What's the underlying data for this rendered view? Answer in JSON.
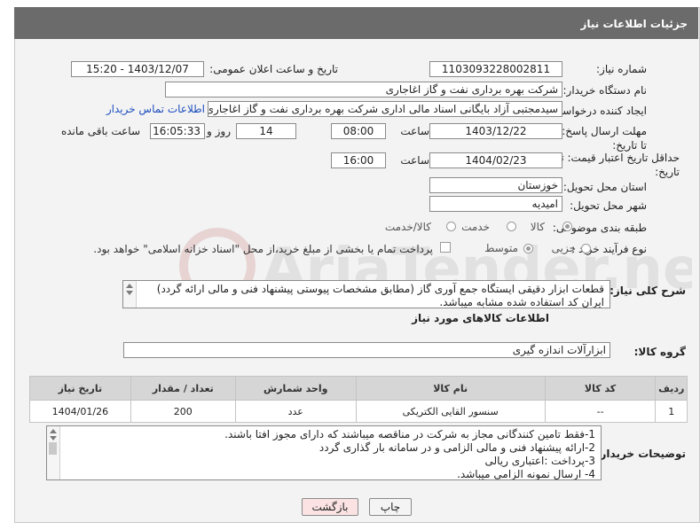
{
  "header": {
    "title": "جزئیات اطلاعات نیاز"
  },
  "fields": {
    "need_number_label": "شماره نیاز:",
    "need_number": "1103093228002811",
    "announce_label": "تاریخ و ساعت اعلان عمومی:",
    "announce_value": "1403/12/07 - 15:20",
    "buyer_org_label": "نام دستگاه خریدار:",
    "buyer_org": "شرکت بهره برداری نفت و گاز اغاجاری",
    "creator_label": "ایجاد کننده درخواست:",
    "creator": "سیدمجتبی آزاد بایگانی اسناد مالی اداری شرکت بهره برداری نفت و گاز اغاجاری",
    "contact_link": "اطلاعات تماس خریدار",
    "deadline_label": "مهلت ارسال پاسخ: تا تاریخ:",
    "deadline_date": "1403/12/22",
    "time_label": "ساعت",
    "deadline_time": "08:00",
    "days_count": "14",
    "days_label": "روز و",
    "remaining_time": "16:05:33",
    "remaining_label": "ساعت باقی مانده",
    "validity_label": "حداقل تاریخ اعتبار قیمت: تا تاریخ:",
    "validity_date": "1404/02/23",
    "validity_time": "16:00",
    "province_label": "استان محل تحویل:",
    "province": "خوزستان",
    "city_label": "شهر محل تحویل:",
    "city": "امیدیه",
    "category_label": "طبقه بندی موضوعی:",
    "category_options": [
      "کالا",
      "خدمت",
      "کالا/خدمت"
    ],
    "process_label": "نوع فرآیند خرید :",
    "process_options": [
      "جزیی",
      "متوسط"
    ],
    "payment_text": "پرداخت تمام یا بخشی از مبلغ خرید،از محل \"اسناد خزانه اسلامی\" خواهد بود."
  },
  "description": {
    "label": "شرح کلی نیاز:",
    "lines": [
      "قطعات ابزار دقیقی ایستگاه جمع آوری گاز (مطابق مشخصات پیوستی پیشنهاد فنی و مالی ارائه گردد)",
      "ایران کد استفاده شده مشابه میباشد."
    ]
  },
  "goods": {
    "section_title": "اطلاعات کالاهای مورد نیاز",
    "group_label": "گروه کالا:",
    "group_value": "ابزارآلات اندازه گیری",
    "columns": [
      "ردیف",
      "کد کالا",
      "نام کالا",
      "واحد شمارش",
      "تعداد / مقدار",
      "تاریخ نیاز"
    ],
    "rows": [
      [
        "1",
        "--",
        "سنسور القایی الکتریکی",
        "عدد",
        "200",
        "1404/01/26"
      ]
    ]
  },
  "buyer_notes": {
    "label": "توضیحات خریدار:",
    "lines": [
      "1-فقط تامین کنندگانی مجاز به شرکت در مناقصه میباشند  که دارای مجوز افتا باشند.",
      "2-ارائه پیشنهاد فنی و مالی الزامی و در سامانه بار گذاری گردد",
      "3-پرداخت :اعتباری ریالی",
      "4-  ارسال نمونه الزامی میباشد."
    ]
  },
  "buttons": {
    "print": "چاپ",
    "back": "بازگشت"
  },
  "watermark": "AriaTender.neT"
}
